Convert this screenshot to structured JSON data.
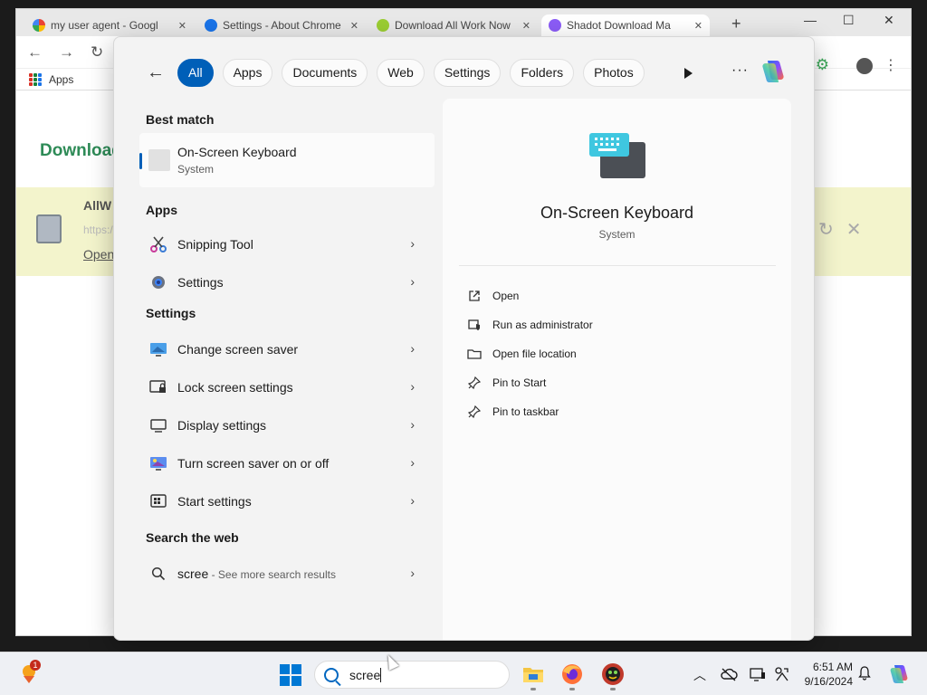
{
  "browser": {
    "tabs": [
      {
        "title": "my user agent - Googl"
      },
      {
        "title": "Settings - About Chrome"
      },
      {
        "title": "Download All Work Now"
      },
      {
        "title": "Shadot Download Ma"
      }
    ],
    "bookmarks_apps": "Apps",
    "page_heading": "Download",
    "download_bar": {
      "title": "AllW",
      "url": "https:/",
      "open_link": "Open"
    }
  },
  "search": {
    "filters": [
      "All",
      "Apps",
      "Documents",
      "Web",
      "Settings",
      "Folders",
      "Photos"
    ],
    "active_filter": "All",
    "best_match": {
      "heading": "Best match",
      "name": "On-Screen Keyboard",
      "type": "System"
    },
    "apps": {
      "heading": "Apps",
      "items": [
        {
          "label": "Snipping Tool",
          "icon": "snipping-tool-icon"
        },
        {
          "label": "Settings",
          "icon": "settings-gear-icon"
        }
      ]
    },
    "settings": {
      "heading": "Settings",
      "items": [
        {
          "label": "Change screen saver",
          "icon": "screen-saver-icon"
        },
        {
          "label": "Lock screen settings",
          "icon": "lock-screen-icon"
        },
        {
          "label": "Display settings",
          "icon": "display-icon"
        },
        {
          "label": "Turn screen saver on or off",
          "icon": "screen-saver-toggle-icon"
        },
        {
          "label": "Start settings",
          "icon": "start-settings-icon"
        }
      ]
    },
    "web": {
      "heading": "Search the web",
      "query": "scree",
      "suffix": " - See more search results"
    },
    "detail": {
      "title": "On-Screen Keyboard",
      "subtitle": "System",
      "actions": [
        {
          "label": "Open",
          "icon": "open-external-icon"
        },
        {
          "label": "Run as administrator",
          "icon": "shield-admin-icon"
        },
        {
          "label": "Open file location",
          "icon": "folder-icon"
        },
        {
          "label": "Pin to Start",
          "icon": "pin-icon"
        },
        {
          "label": "Pin to taskbar",
          "icon": "pin-icon"
        }
      ]
    }
  },
  "taskbar": {
    "weather_badge": "1",
    "search_text": "scree",
    "clock_time": "6:51 AM",
    "clock_date": "9/16/2024"
  },
  "colors": {
    "accent": "#005fb8",
    "taskbar_bg": "#eef0f4",
    "download_bar_bg": "#f3f4cc"
  }
}
